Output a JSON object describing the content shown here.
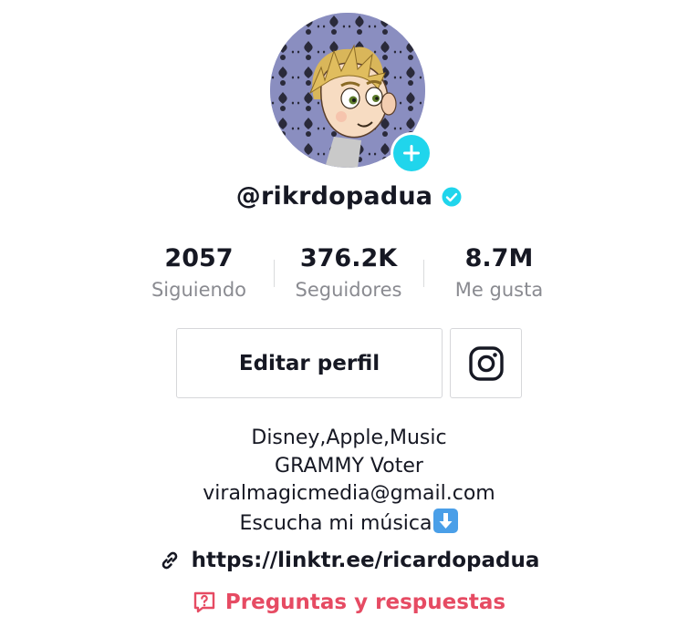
{
  "profile": {
    "username": "@rikrdopadua",
    "verified": true
  },
  "stats": [
    {
      "value": "2057",
      "label": "Siguiendo"
    },
    {
      "value": "376.2K",
      "label": "Seguidores"
    },
    {
      "value": "8.7M",
      "label": "Me gusta"
    }
  ],
  "actions": {
    "edit_label": "Editar perfil",
    "social_icon": "instagram-icon"
  },
  "bio": {
    "lines": [
      "Disney,Apple,Music",
      "GRAMMY Voter",
      "viralmagicmedia@gmail.com",
      "Escucha mi música"
    ],
    "last_line_emoji": "down-arrow-emoji"
  },
  "link": {
    "url": "https://linktr.ee/ricardopadua",
    "icon": "link-icon"
  },
  "qa": {
    "label": "Preguntas y respuestas",
    "icon": "question-bubble-icon"
  },
  "colors": {
    "accent": "#20d5ec",
    "verified": "#20d5ec",
    "qa": "#e64b63",
    "text": "#161823",
    "muted": "#8a8b91"
  }
}
